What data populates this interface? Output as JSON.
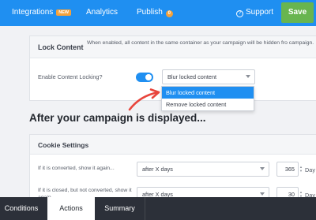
{
  "nav": {
    "integrations_label": "Integrations",
    "integrations_badge": "NEW",
    "analytics_label": "Analytics",
    "publish_label": "Publish",
    "publish_badge": "0",
    "support_label": "Support",
    "save_label": "Save"
  },
  "lock": {
    "title": "Lock Content",
    "description": "When enabled, all content in the same container as your campaign will be hidden fro campaign.",
    "enable_label": "Enable Content Locking?",
    "toggle_on": true,
    "select_value": "Blur locked content",
    "options": [
      "Blur locked content",
      "Remove locked content"
    ]
  },
  "after": {
    "heading": "After your campaign is displayed..."
  },
  "cookie": {
    "title": "Cookie Settings",
    "row1_label": "If it is converted, show it again...",
    "row1_select": "after X days",
    "row1_value": "365",
    "row1_unit": "Day",
    "row2_label": "If it is closed, but not converted, show it again...",
    "row2_select": "after X days",
    "row2_value": "30",
    "row2_unit": "Day"
  },
  "tabs": {
    "conditions": "Conditions",
    "actions": "Actions",
    "summary": "Summary"
  },
  "colors": {
    "accent": "#1f8ff1",
    "save": "#68b54f",
    "badge": "#f6a23a",
    "arrow": "#e8453c",
    "tabbar": "#2c3039"
  }
}
